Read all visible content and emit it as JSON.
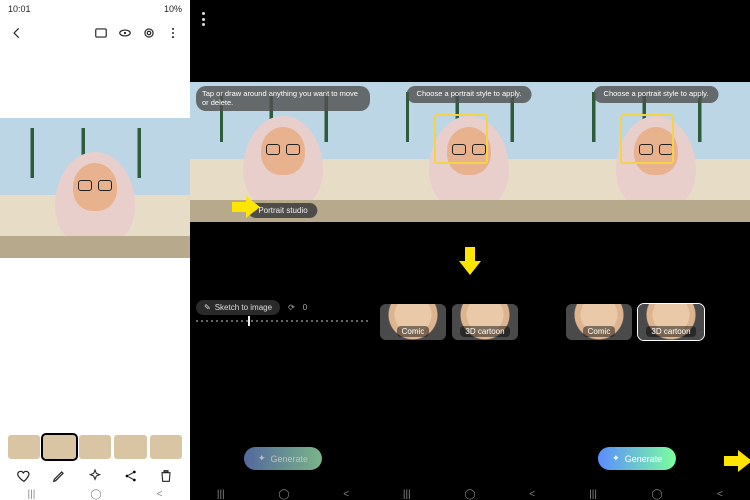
{
  "p1": {
    "status": {
      "time": "10:01",
      "right": "10%"
    },
    "bottombar": [
      "heart-icon",
      "pencil-icon",
      "sparkle-icon",
      "share-icon",
      "trash-icon"
    ]
  },
  "p2": {
    "tip": "Tap or draw around anything you want to move or delete.",
    "pill": "Portrait studio",
    "toolbtn": "Sketch to image",
    "sliderval": "0",
    "generate": "Generate"
  },
  "p3": {
    "tip": "Choose a portrait style to apply.",
    "chips": [
      {
        "label": "Comic",
        "selected": false
      },
      {
        "label": "3D cartoon",
        "selected": false
      }
    ]
  },
  "p4": {
    "tip": "Choose a portrait style to apply.",
    "chips": [
      {
        "label": "Comic",
        "selected": false
      },
      {
        "label": "3D cartoon",
        "selected": true
      }
    ],
    "generate": "Generate"
  },
  "nav": {
    "recents": "|||",
    "home": "◯",
    "back": "<"
  }
}
